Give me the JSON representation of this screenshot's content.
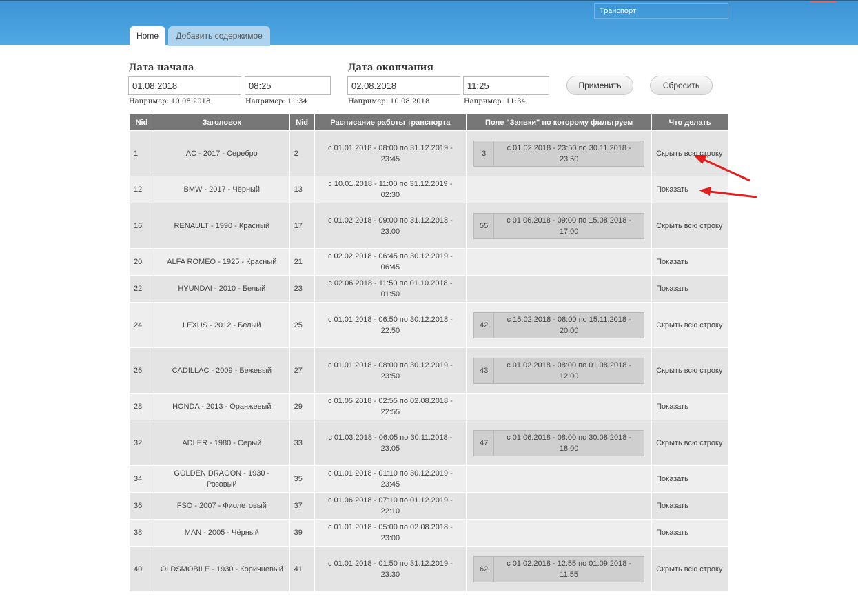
{
  "header": {
    "search_value": "Транспорт",
    "tabs": [
      {
        "label": "Home"
      },
      {
        "label": "Добавить содержимое"
      }
    ]
  },
  "filters": {
    "start": {
      "label": "Дата начала",
      "date": "01.08.2018",
      "time": "08:25",
      "date_hint": "Например: 10.08.2018",
      "time_hint": "Например: 11:34"
    },
    "end": {
      "label": "Дата окончания",
      "date": "02.08.2018",
      "time": "11:25",
      "date_hint": "Например: 10.08.2018",
      "time_hint": "Например: 11:34"
    },
    "apply_label": "Применить",
    "reset_label": "Сбросить"
  },
  "table": {
    "columns": [
      "Nid",
      "Заголовок",
      "Nid",
      "Расписание работы транспорта",
      "Поле \"Заявки\" по которому фильтруем",
      "Что делать"
    ],
    "rows": [
      {
        "nid": "1",
        "title": "AC - 2017 - Серебро",
        "nid2": "2",
        "schedule": "с 01.01.2018 - 08:00 по 31.12.2019 - 23:45",
        "req_id": "3",
        "req_text": "с 01.02.2018 - 23:50 по 30.11.2018 - 23:50",
        "action": "Скрыть всю строку"
      },
      {
        "nid": "12",
        "title": "BMW - 2017 - Чёрный",
        "nid2": "13",
        "schedule": "с 10.01.2018 - 11:00 по 31.12.2019 - 02:30",
        "req_id": "",
        "req_text": "",
        "action": "Показать"
      },
      {
        "nid": "16",
        "title": "RENAULT - 1990 - Красный",
        "nid2": "17",
        "schedule": "с 01.02.2018 - 09:00 по 31.12.2018 - 23:00",
        "req_id": "55",
        "req_text": "с 01.06.2018 - 09:00 по 15.08.2018 - 17:00",
        "action": "Скрыть всю строку"
      },
      {
        "nid": "20",
        "title": "ALFA ROMEO - 1925 - Красный",
        "nid2": "21",
        "schedule": "с 02.02.2018 - 06:45 по 30.12.2019 - 06:45",
        "req_id": "",
        "req_text": "",
        "action": "Показать"
      },
      {
        "nid": "22",
        "title": "HYUNDAI - 2010 - Белый",
        "nid2": "23",
        "schedule": "с 02.06.2018 - 11:50 по 01.10.2018 - 01:50",
        "req_id": "",
        "req_text": "",
        "action": "Показать"
      },
      {
        "nid": "24",
        "title": "LEXUS - 2012 - Белый",
        "nid2": "25",
        "schedule": "с 01.01.2018 - 06:50 по 30.12.2018 - 22:50",
        "req_id": "42",
        "req_text": "с 15.02.2018 - 08:00 по 15.11.2018 - 20:00",
        "action": "Скрыть всю строку"
      },
      {
        "nid": "26",
        "title": "CADILLAC - 2009 - Бежевый",
        "nid2": "27",
        "schedule": "с 01.01.2018 - 08:00 по 30.12.2019 - 23:50",
        "req_id": "43",
        "req_text": "с 01.02.2018 - 08:00 по 01.08.2018 - 12:00",
        "action": "Скрыть всю строку"
      },
      {
        "nid": "28",
        "title": "HONDA - 2013 - Оранжевый",
        "nid2": "29",
        "schedule": "с 01.05.2018 - 02:55 по 02.08.2018 - 22:55",
        "req_id": "",
        "req_text": "",
        "action": "Показать"
      },
      {
        "nid": "32",
        "title": "ADLER - 1980 - Серый",
        "nid2": "33",
        "schedule": "с 01.03.2018 - 06:05 по 30.11.2018 - 23:05",
        "req_id": "47",
        "req_text": "с 01.06.2018 - 08:00 по 30.08.2018 - 18:00",
        "action": "Скрыть всю строку"
      },
      {
        "nid": "34",
        "title": "GOLDEN DRAGON - 1930 - Розовый",
        "nid2": "35",
        "schedule": "с 01.01.2018 - 01:10 по 30.12.2019 - 23:45",
        "req_id": "",
        "req_text": "",
        "action": "Показать"
      },
      {
        "nid": "36",
        "title": "FSO - 2007 - Фиолетовый",
        "nid2": "37",
        "schedule": "с 01.06.2018 - 07:10 по 01.12.2019 - 22:10",
        "req_id": "",
        "req_text": "",
        "action": "Показать"
      },
      {
        "nid": "38",
        "title": "MAN - 2005 - Чёрный",
        "nid2": "39",
        "schedule": "с 01.01.2018 - 05:00 по 02.08.2018 - 23:00",
        "req_id": "",
        "req_text": "",
        "action": "Показать"
      },
      {
        "nid": "40",
        "title": "OLDSMOBILE - 1930 - Коричневый",
        "nid2": "41",
        "schedule": "с 01.01.2018 - 01:50 по 31.12.2019 - 23:30",
        "req_id": "62",
        "req_text": "с 01.02.2018 - 12:55 по 01.09.2018 - 11:55",
        "action": "Скрыть всю строку"
      }
    ]
  },
  "colors": {
    "header": "#4fa8e2",
    "table_head": "#777777",
    "arrow": "#e31e1e"
  }
}
